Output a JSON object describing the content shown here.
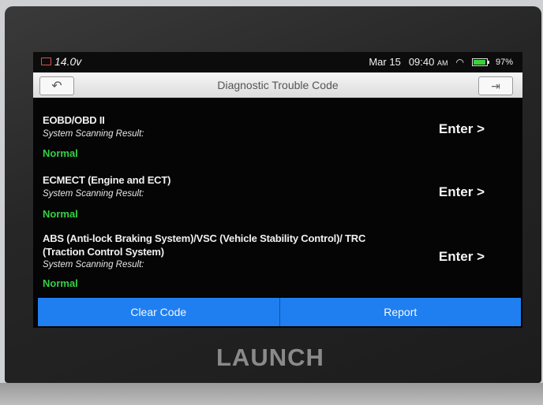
{
  "status_bar": {
    "voltage": "14.0v",
    "date": "Mar 15",
    "time": "09:40",
    "ampm": "AM",
    "battery_percent": "97%",
    "battery_level": 0.97
  },
  "header": {
    "title": "Diagnostic Trouble Code"
  },
  "systems": [
    {
      "name": "EOBD/OBD II",
      "subtitle": "System Scanning Result:",
      "status": "Normal",
      "enter_label": "Enter >"
    },
    {
      "name": "ECMECT (Engine and ECT)",
      "subtitle": "System Scanning Result:",
      "status": "Normal",
      "enter_label": "Enter >"
    },
    {
      "name": "ABS (Anti-lock Braking System)/VSC (Vehicle Stability Control)/ TRC (Traction Control System)",
      "subtitle": "System Scanning Result:",
      "status": "Normal",
      "enter_label": "Enter >"
    }
  ],
  "actions": {
    "clear_code": "Clear Code",
    "report": "Report"
  },
  "device": {
    "brand": "LAUNCH"
  },
  "colors": {
    "accent_blue": "#1f7ff0",
    "status_green": "#33d046"
  }
}
